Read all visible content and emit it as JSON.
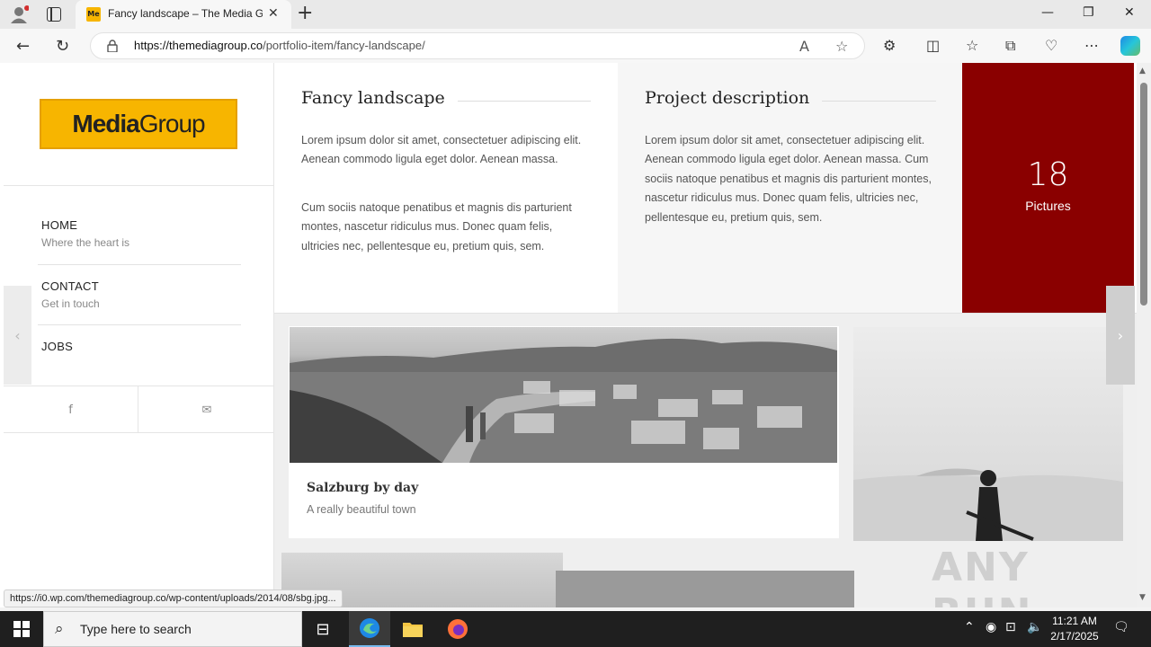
{
  "browser": {
    "tab_title": "Fancy landscape – The Media Gro",
    "favicon_text": "Me",
    "url_domain": "https://themediagroup.co",
    "url_path": "/portfolio-item/fancy-landscape/",
    "status_url": "https://i0.wp.com/themediagroup.co/wp-content/uploads/2014/08/sbg.jpg..."
  },
  "sidebar": {
    "logo_bold": "Media",
    "logo_light": "Group",
    "menu": [
      {
        "title": "HOME",
        "subtitle": "Where the heart is"
      },
      {
        "title": "CONTACT",
        "subtitle": "Get in touch"
      },
      {
        "title": "JOBS",
        "subtitle": ""
      }
    ],
    "social": {
      "facebook_icon": "f",
      "mail_icon": "✉"
    }
  },
  "project": {
    "title": "Fancy landscape",
    "para1": "Lorem ipsum dolor sit amet, consectetuer adipiscing elit. Aenean commodo ligula eget dolor. Aenean massa.",
    "para2": "Cum sociis natoque penatibus et magnis dis parturient montes, nascetur ridiculus mus. Donec quam felis, ultricies nec, pellentesque eu, pretium quis, sem.",
    "desc_title": "Project description",
    "desc_para": "Lorem ipsum dolor sit amet, consectetuer adipiscing elit. Aenean commodo ligula eget dolor. Aenean massa. Cum sociis natoque penatibus et magnis dis parturient montes, nascetur ridiculus mus. Donec quam felis, ultricies nec, pellentesque eu, pretium quis, sem.",
    "pictures_count": "18",
    "pictures_label": "Pictures"
  },
  "gallery": {
    "card_title": "Salzburg by day",
    "card_subtitle": "A really beautiful town"
  },
  "watermark": "ANY RUN",
  "taskbar": {
    "search_placeholder": "Type here to search",
    "time": "11:21 AM",
    "date": "2/17/2025"
  },
  "colors": {
    "accent_red": "#8a0000",
    "logo_yellow": "#f7b500"
  }
}
